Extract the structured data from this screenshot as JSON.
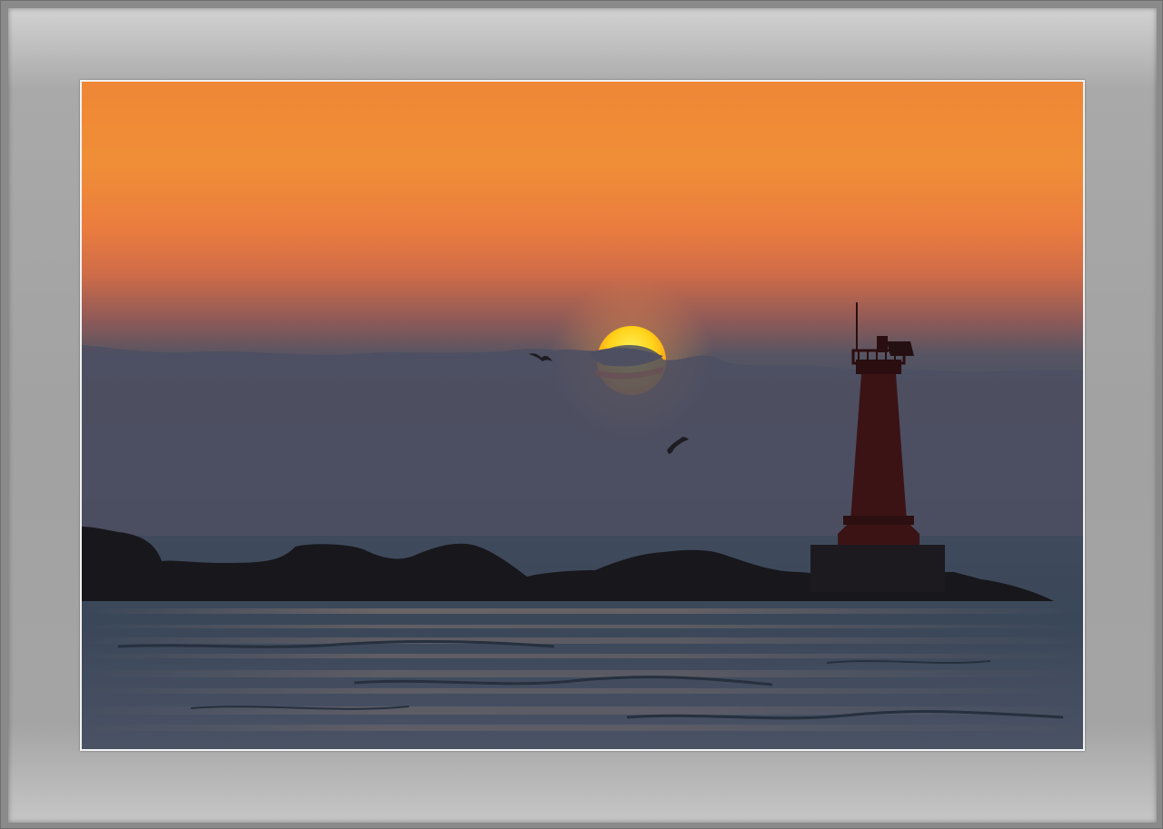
{
  "image": {
    "subject": "lighthouse-at-sunset",
    "colors": {
      "sky_top": "#f08c34",
      "sky_mid": "#e9783f",
      "sky_low": "#b06452",
      "haze": "#4a4e62",
      "sun": "#ffd21a",
      "sun_edge": "#ff5a10",
      "sea": "#3a4658",
      "rocks": "#17161a",
      "lighthouse": "#3a1214",
      "mat": "#a4a4a4"
    }
  }
}
